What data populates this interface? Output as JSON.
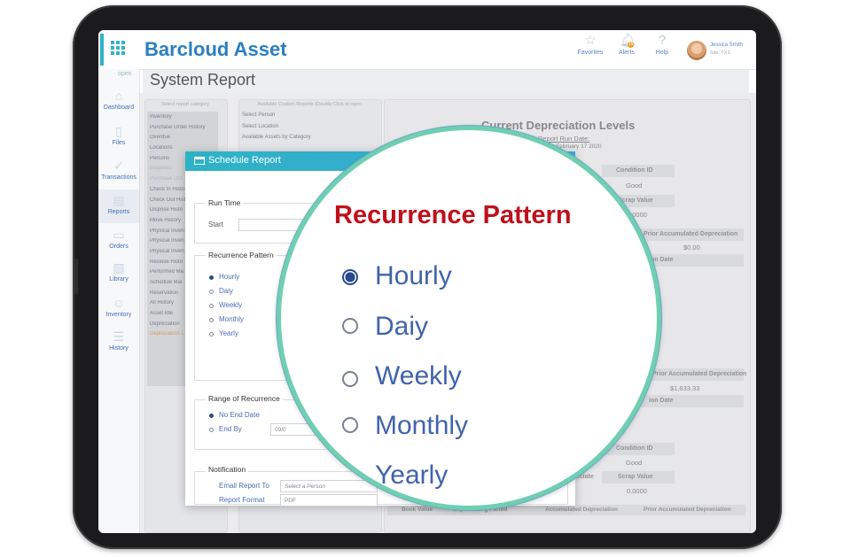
{
  "app": {
    "brand": "Barcloud Asset",
    "page_title": "System Report"
  },
  "header": {
    "favorites": "Favorites",
    "alerts": "Alerts",
    "alerts_count": "15",
    "help": "Help",
    "user_name": "Jessica Smith",
    "user_site": "Site: TX3"
  },
  "sidebar": {
    "open": "open",
    "items": [
      {
        "label": "Dashboard",
        "icon": "home-icon"
      },
      {
        "label": "Files",
        "icon": "file-icon"
      },
      {
        "label": "Transactions",
        "icon": "check-circle-icon"
      },
      {
        "label": "Reports",
        "icon": "chart-icon"
      },
      {
        "label": "Orders",
        "icon": "orders-icon"
      },
      {
        "label": "Library",
        "icon": "image-icon"
      },
      {
        "label": "Inventory",
        "icon": "user-icon"
      },
      {
        "label": "History",
        "icon": "history-icon"
      }
    ]
  },
  "category_panel": {
    "header": "Select report category",
    "items": [
      "Inventory",
      "Purchase Order History",
      "Overdue",
      "Locations",
      "Persons",
      "Suppliers",
      "Purchase Ord",
      "Check In Histo",
      "Check Out Hist",
      "Dispose Histo",
      "Move History",
      "Physical Inven",
      "Physical Inven",
      "Physical Inven",
      "Receive Histo",
      "Performed Ma",
      "Schedule Mai",
      "Reservation",
      "All History",
      "Asset Idle",
      "Depreciation",
      "Depreciation L"
    ]
  },
  "reports_panel": {
    "header": "Available Custom Reports (Double Click to open",
    "items": [
      "Select Person",
      "Select Location",
      "Available Assets by Category"
    ]
  },
  "preview": {
    "title": "Current Depreciation Levels",
    "run_date_label": "Report Run Date:",
    "run_date": "Monday, February 17 2020",
    "condition_id": "Condition ID",
    "good": "Good",
    "scrap_value": "Scrap Value",
    "scrap_amount": "0.0000",
    "prior_acc_dep": "Prior Accumulated Depreciation",
    "amount_zero": "$0.00",
    "amount_2": "$1,633.33",
    "ion_date": "ion Date",
    "partial_ile": "ile",
    "partial_epreciate": "epreciate",
    "footer_cols": [
      "Book Value",
      "Depreciating Period",
      "Accumulated Depreciation",
      "Prior Accumulated Depreciation"
    ]
  },
  "modal": {
    "title": "Schedule Report",
    "run_time": "Run Time",
    "start": "Start",
    "recurrence_pattern": "Recurrence Pattern",
    "options": [
      "Hourly",
      "Daiy",
      "Weekly",
      "Monthly",
      "Yearly"
    ],
    "selected": "Hourly",
    "range": "Range of Recurrence",
    "no_end_date": "No End Date",
    "end_by": "End By",
    "end_by_value": "09/0",
    "notification": "Notification",
    "email_report_to": "Email Report To",
    "email_placeholder": "Select a Person",
    "report_format": "Report Format",
    "report_format_value": "PDF"
  },
  "lens": {
    "title": "Recurrence Pattern",
    "options": [
      "Hourly",
      "Daiy",
      "Weekly",
      "Monthly",
      "Yearly"
    ]
  },
  "colors": {
    "brand": "#2a7fc0",
    "accent": "#2fb3c6",
    "lens_title": "#c0101a",
    "option": "#4163ab"
  }
}
